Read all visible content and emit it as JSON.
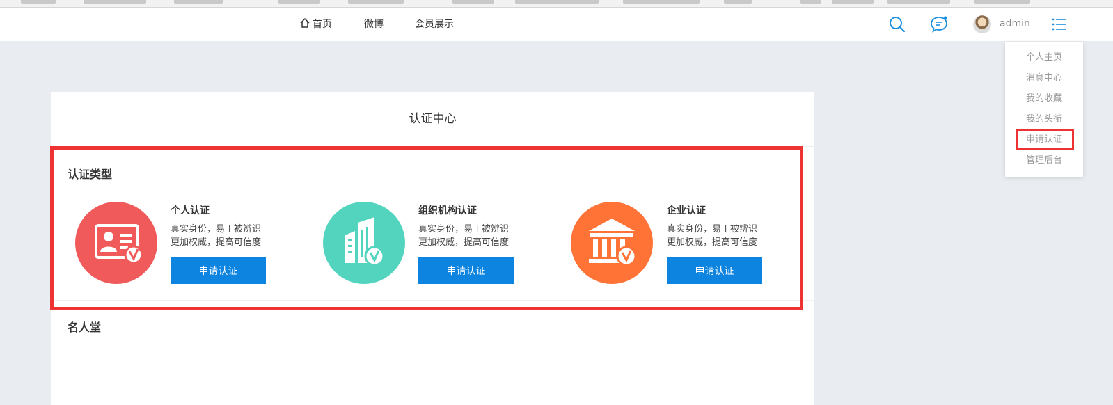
{
  "nav": {
    "home": "首页",
    "weibo": "微博",
    "members": "会员展示"
  },
  "header": {
    "username": "admin",
    "icons": [
      "search-icon",
      "message-icon",
      "menu-icon"
    ]
  },
  "dropdown": {
    "items": [
      "个人主页",
      "消息中心",
      "我的收藏",
      "我的头衔",
      "申请认证",
      "管理后台"
    ],
    "highlighted": "申请认证"
  },
  "panel": {
    "title": "认证中心",
    "section_types": "认证类型",
    "section_hall": "名人堂"
  },
  "cards": [
    {
      "title": "个人认证",
      "desc1": "真实身份，易于被辨识",
      "desc2": "更加权威，提高可信度",
      "button": "申请认证",
      "color": "#f05a5a",
      "icon": "id-card-icon"
    },
    {
      "title": "组织机构认证",
      "desc1": "真实身份，易于被辨识",
      "desc2": "更加权威，提高可信度",
      "button": "申请认证",
      "color": "#52d4be",
      "icon": "building-icon"
    },
    {
      "title": "企业认证",
      "desc1": "真实身份，易于被辨识",
      "desc2": "更加权威，提高可信度",
      "button": "申请认证",
      "color": "#ff7337",
      "icon": "bank-icon"
    }
  ],
  "colors": {
    "accent": "#0d84e0",
    "highlight": "#ee3333",
    "background": "#e9ecf0"
  }
}
